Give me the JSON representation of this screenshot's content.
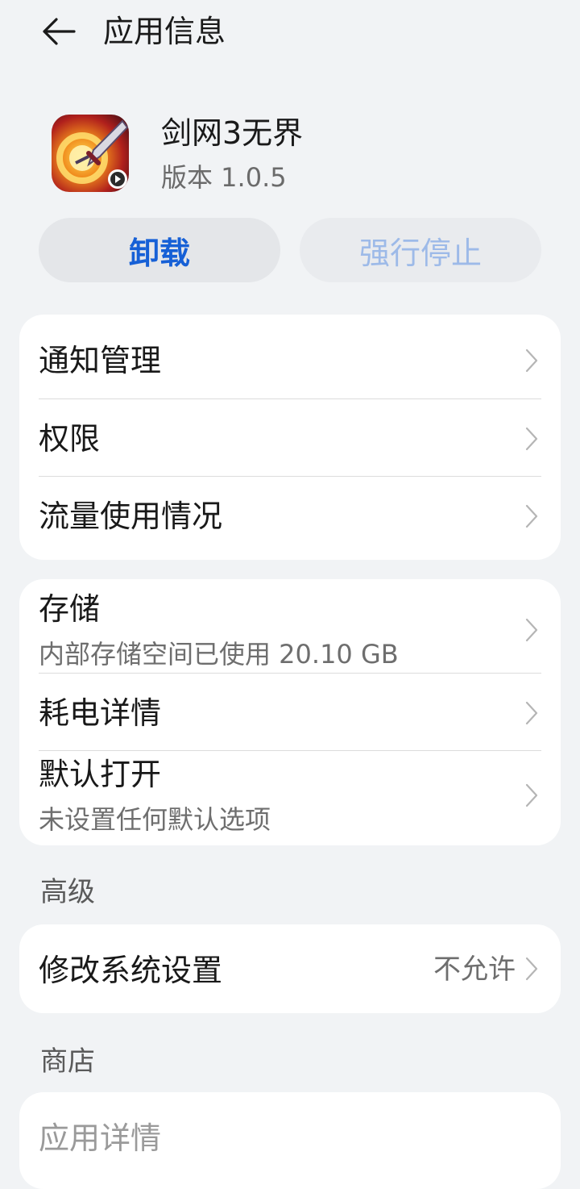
{
  "header": {
    "title": "应用信息",
    "back_icon": "arrow-left-icon"
  },
  "app": {
    "name": "剑网3无界",
    "version": "版本 1.0.5",
    "icon": "app-game-icon"
  },
  "actions": {
    "uninstall_label": "卸载",
    "force_stop_label": "强行停止",
    "accent_color": "#1660d6",
    "disabled_color": "#9dbae8"
  },
  "group1": {
    "items": [
      {
        "label": "通知管理"
      },
      {
        "label": "权限"
      },
      {
        "label": "流量使用情况"
      }
    ]
  },
  "group2": {
    "storage": {
      "label": "存储",
      "sub": "内部存储空间已使用 20.10 GB"
    },
    "battery": {
      "label": "耗电详情"
    },
    "default_open": {
      "label": "默认打开",
      "sub": "未设置任何默认选项"
    }
  },
  "advanced": {
    "section_label": "高级",
    "modify_settings": {
      "label": "修改系统设置",
      "value": "不允许"
    }
  },
  "store": {
    "section_label": "商店",
    "app_details": {
      "label": "应用详情"
    }
  }
}
